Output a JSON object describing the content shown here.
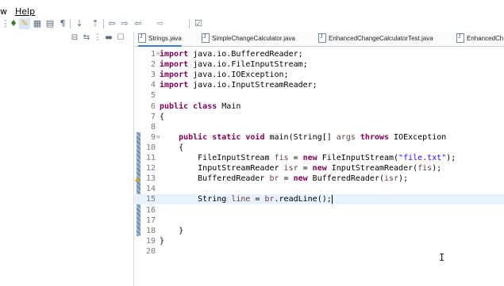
{
  "menu": {
    "items": [
      "w",
      "Help"
    ]
  },
  "toolbar": {
    "icons": [
      "toggle-icon",
      "search-icon",
      "pin-icon",
      "highlight-icon",
      "show-whitespace-icon",
      "pilcrow-icon",
      "next-annotation-icon",
      "prev-annotation-icon",
      "back-icon",
      "back-menu-icon",
      "forward-icon",
      "forward-menu-icon",
      "new-task-icon"
    ]
  },
  "left_panel": {
    "icons": [
      "collapse-all-icon",
      "link-editor-icon",
      "view-menu-icon",
      "minimize-icon",
      "maximize-icon"
    ]
  },
  "tabs": [
    {
      "label": "Strings.java"
    },
    {
      "label": "SimpleChangeCalculator.java"
    },
    {
      "label": "EnhancedChangeCalculatorTest.java"
    },
    {
      "label": "EnhancedCh"
    }
  ],
  "editor": {
    "lines": [
      {
        "n": "1",
        "fold": "⊖",
        "tokens": [
          [
            "kw",
            "import"
          ],
          [
            "",
            "java.io.BufferedReader;"
          ]
        ]
      },
      {
        "n": "2",
        "tokens": [
          [
            "kw",
            "import"
          ],
          [
            "",
            "java.io.FileInputStream;"
          ]
        ]
      },
      {
        "n": "3",
        "tokens": [
          [
            "kw",
            "import"
          ],
          [
            "",
            "java.io.IOException;"
          ]
        ]
      },
      {
        "n": "4",
        "tokens": [
          [
            "kw",
            "import"
          ],
          [
            "",
            "java.io.InputStreamReader;"
          ]
        ]
      },
      {
        "n": "5",
        "tokens": []
      },
      {
        "n": "6",
        "tokens": [
          [
            "kw",
            "public class"
          ],
          [
            "",
            "Main"
          ]
        ]
      },
      {
        "n": "7",
        "tokens": [
          [
            "",
            "{"
          ]
        ]
      },
      {
        "n": "8",
        "tokens": []
      },
      {
        "n": "9",
        "fold": "⊖",
        "tokens": [
          [
            "",
            "    "
          ],
          [
            "kw",
            "public static void"
          ],
          [
            "",
            " main(String[] "
          ],
          [
            "ident",
            "args"
          ],
          [
            "",
            " "
          ],
          [
            "kw",
            "throws"
          ],
          [
            "",
            " IOException"
          ]
        ]
      },
      {
        "n": "10",
        "tokens": [
          [
            "",
            "    {"
          ]
        ]
      },
      {
        "n": "11",
        "tokens": [
          [
            "",
            "        FileInputStream "
          ],
          [
            "ident",
            "fis"
          ],
          [
            "",
            " = "
          ],
          [
            "kw",
            "new"
          ],
          [
            "",
            " FileInputStream("
          ],
          [
            "str",
            "\"file.txt\""
          ],
          [
            "",
            ");"
          ]
        ]
      },
      {
        "n": "12",
        "tokens": [
          [
            "",
            "        InputStreamReader "
          ],
          [
            "ident",
            "isr"
          ],
          [
            "",
            " = "
          ],
          [
            "kw",
            "new"
          ],
          [
            "",
            " InputStreamReader("
          ],
          [
            "ident",
            "fis"
          ],
          [
            "",
            ");"
          ]
        ]
      },
      {
        "n": "13",
        "tokens": [
          [
            "",
            "        BufferedReader "
          ],
          [
            "ident",
            "br"
          ],
          [
            "",
            " = "
          ],
          [
            "kw",
            "new"
          ],
          [
            "",
            " BufferedReader("
          ],
          [
            "ident",
            "isr"
          ],
          [
            "",
            ");"
          ]
        ]
      },
      {
        "n": "14",
        "tokens": []
      },
      {
        "n": "15",
        "current": true,
        "tokens": [
          [
            "",
            "        String "
          ],
          [
            "ident",
            "line"
          ],
          [
            "",
            " = "
          ],
          [
            "ident",
            "br"
          ],
          [
            "",
            ".readLine();"
          ]
        ]
      },
      {
        "n": "16",
        "tokens": []
      },
      {
        "n": "17",
        "tokens": []
      },
      {
        "n": "18",
        "tokens": [
          [
            "",
            "    }"
          ]
        ]
      },
      {
        "n": "19",
        "tokens": [
          [
            "",
            "}"
          ]
        ]
      },
      {
        "n": "20",
        "tokens": []
      }
    ],
    "changed_lines": [
      9,
      10,
      11,
      12,
      13,
      14,
      15,
      16,
      17,
      18
    ],
    "warning_lines": [
      13,
      15
    ]
  }
}
